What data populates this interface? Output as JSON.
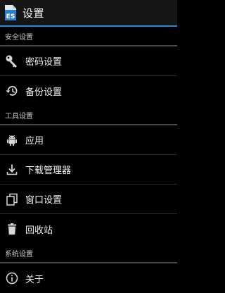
{
  "window": {
    "title": "设置",
    "app_icon": "es-file-explorer-icon"
  },
  "sections": [
    {
      "header": "安全设置",
      "items": [
        {
          "label": "密码设置",
          "icon": "key-icon"
        },
        {
          "label": "备份设置",
          "icon": "history-restore-icon"
        }
      ]
    },
    {
      "header": "工具设置",
      "items": [
        {
          "label": "应用",
          "icon": "android-icon"
        },
        {
          "label": "下载管理器",
          "icon": "download-icon"
        },
        {
          "label": "窗口设置",
          "icon": "windows-stack-icon"
        },
        {
          "label": "回收站",
          "icon": "trash-icon"
        }
      ]
    },
    {
      "header": "系统设置",
      "items": [
        {
          "label": "关于",
          "icon": "info-icon"
        }
      ]
    }
  ],
  "colors": {
    "background": "#000000",
    "action_bar": "#161616",
    "accent_underline": "#2a8ad8",
    "section_divider": "#4a4a4a",
    "item_divider": "#2c2c2c"
  }
}
